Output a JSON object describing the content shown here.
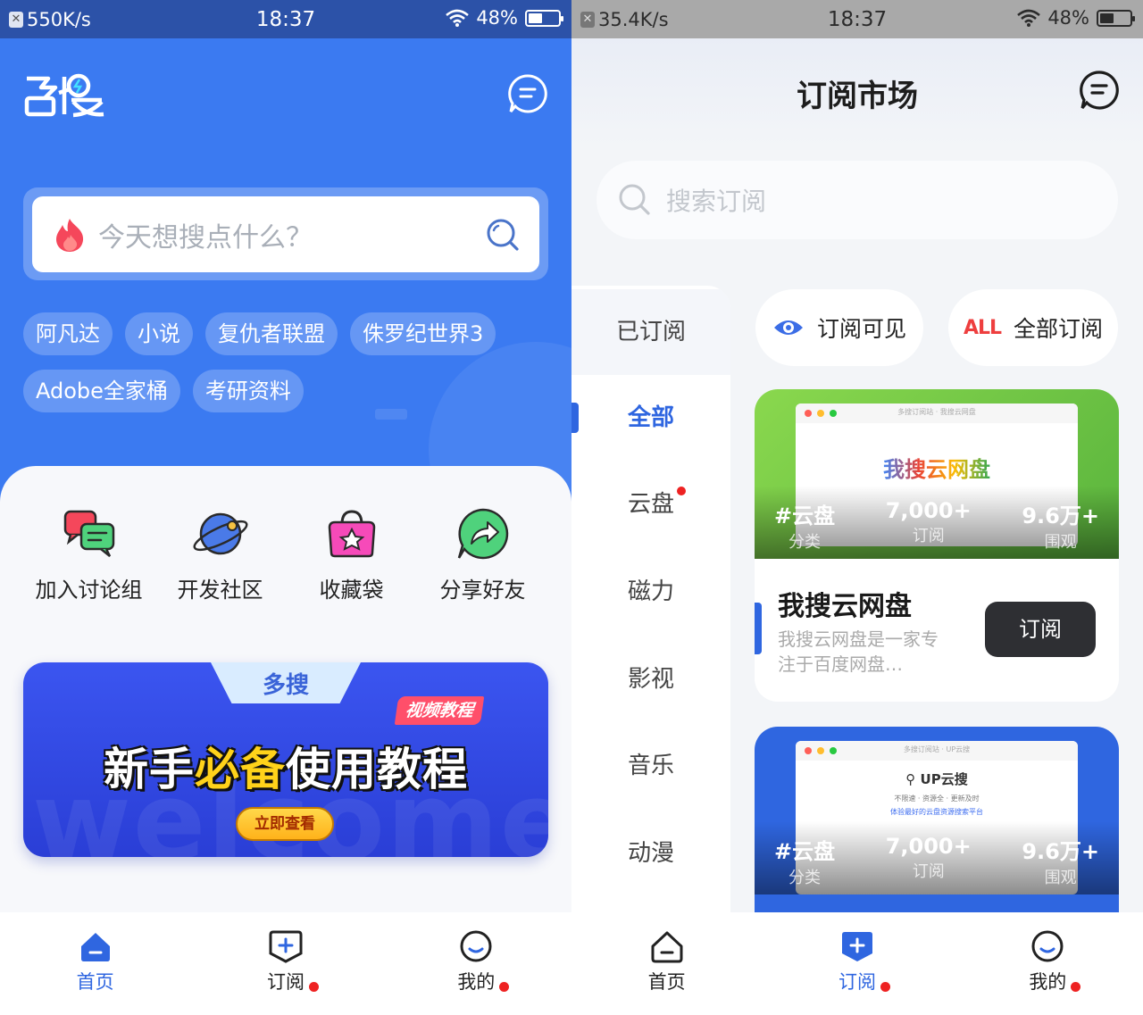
{
  "left": {
    "status": {
      "speed": "550K/s",
      "time": "18:37",
      "battery": "48%",
      "battery_level": 0.48
    },
    "logo_text": "多搜",
    "search": {
      "placeholder": "今天想搜点什么？"
    },
    "hot_tags": [
      "阿凡达",
      "小说",
      "复仇者联盟",
      "侏罗纪世界3",
      "Adobe全家桶",
      "考研资料"
    ],
    "quick_actions": [
      {
        "label": "加入讨论组",
        "icon": "chat-bubbles-icon"
      },
      {
        "label": "开发社区",
        "icon": "planet-icon"
      },
      {
        "label": "收藏袋",
        "icon": "star-bag-icon"
      },
      {
        "label": "分享好友",
        "icon": "share-arrow-icon"
      }
    ],
    "banner": {
      "logo": "多搜",
      "badge": "视频教程",
      "headline_part1": "新手",
      "headline_highlight": "必备",
      "headline_part2": "使用教程",
      "cta": "立即查看",
      "ghost_text": "welcome"
    },
    "nav": [
      {
        "label": "首页",
        "active": true,
        "dot": false
      },
      {
        "label": "订阅",
        "active": false,
        "dot": true
      },
      {
        "label": "我的",
        "active": false,
        "dot": true
      }
    ]
  },
  "right": {
    "status": {
      "speed": "35.4K/s",
      "time": "18:37",
      "battery": "48%",
      "battery_level": 0.48
    },
    "title": "订阅市场",
    "search": {
      "placeholder": "搜索订阅"
    },
    "categories": [
      "已订阅",
      "全部",
      "云盘",
      "磁力",
      "影视",
      "音乐",
      "动漫"
    ],
    "active_category": "全部",
    "filters": {
      "visible_label": "订阅可见",
      "all_tag": "ALL",
      "all_label": "全部订阅"
    },
    "cards": [
      {
        "thumb_title": "多搜订阅站 · 我搜云网盘",
        "thumb_big": "我搜云网盘",
        "tag": "#云盘",
        "tag_label": "分类",
        "subs": "7,000+",
        "subs_label": "订阅",
        "views": "9.6万+",
        "views_label": "围观",
        "name": "我搜云网盘",
        "desc": "我搜云网盘是一家专注于百度网盘…",
        "button": "订阅"
      },
      {
        "thumb_title": "多搜订阅站 · UP云搜",
        "thumb_big": "UP云搜",
        "thumb_sub": "不限速 · 资源全 · 更新及时",
        "thumb_blue": "体验最好的云盘资源搜索平台",
        "tag": "#云盘",
        "tag_label": "分类",
        "subs": "7,000+",
        "subs_label": "订阅",
        "views": "9.6万+",
        "views_label": "围观"
      }
    ],
    "nav": [
      {
        "label": "首页",
        "active": false,
        "dot": false
      },
      {
        "label": "订阅",
        "active": true,
        "dot": true
      },
      {
        "label": "我的",
        "active": false,
        "dot": true
      }
    ]
  },
  "colors": {
    "primary_blue": "#3b7af1",
    "accent_blue": "#2f66e0",
    "dot_red": "#ee2222",
    "banner_blue": "#3b55f0"
  }
}
